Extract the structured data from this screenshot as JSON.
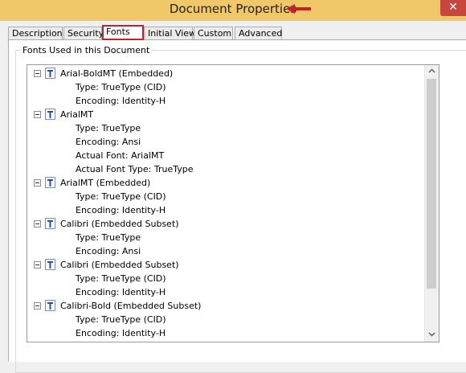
{
  "window": {
    "title": "Document Properties",
    "close_glyph": "✕"
  },
  "tabs": [
    {
      "label": "Description"
    },
    {
      "label": "Security"
    },
    {
      "label": "Fonts"
    },
    {
      "label": "Initial View"
    },
    {
      "label": "Custom"
    },
    {
      "label": "Advanced"
    }
  ],
  "active_tab": "Fonts",
  "fonts_group": {
    "title": "Fonts Used in this Document",
    "fonts": [
      {
        "name": "Arial-BoldMT (Embedded)",
        "details": [
          "Type: TrueType (CID)",
          "Encoding: Identity-H"
        ]
      },
      {
        "name": "ArialMT",
        "details": [
          "Type: TrueType",
          "Encoding: Ansi",
          "Actual Font: ArialMT",
          "Actual Font Type: TrueType"
        ]
      },
      {
        "name": "ArialMT (Embedded)",
        "details": [
          "Type: TrueType (CID)",
          "Encoding: Identity-H"
        ]
      },
      {
        "name": "Calibri (Embedded Subset)",
        "details": [
          "Type: TrueType",
          "Encoding: Ansi"
        ]
      },
      {
        "name": "Calibri (Embedded Subset)",
        "details": [
          "Type: TrueType (CID)",
          "Encoding: Identity-H"
        ]
      },
      {
        "name": "Calibri-Bold (Embedded Subset)",
        "details": [
          "Type: TrueType (CID)",
          "Encoding: Identity-H"
        ]
      }
    ]
  },
  "scrollbar": {
    "up_glyph": "⌃",
    "down_glyph": "⌄"
  },
  "colors": {
    "titlebar": "#f0c86a",
    "close_button": "#c7463e",
    "annotation": "#c0242a",
    "font_icon_blue": "#2a4f9e"
  },
  "icons": {
    "tree_node": "truetype-font-icon",
    "annotation_arrow": "red-arrow-icon"
  }
}
